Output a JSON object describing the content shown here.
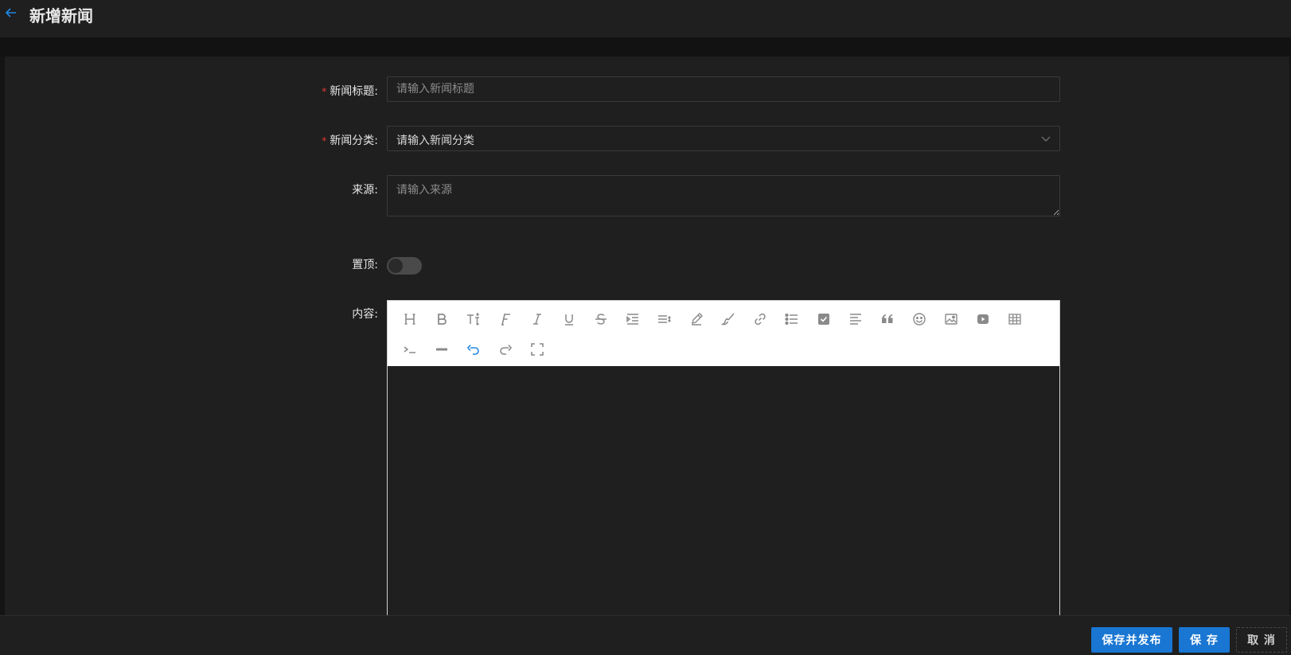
{
  "header": {
    "title": "新增新闻",
    "back_icon": "arrow-left-icon"
  },
  "form": {
    "title_label": "新闻标题:",
    "title_placeholder": "请输入新闻标题",
    "category_label": "新闻分类:",
    "category_value": "请输入新闻分类",
    "source_label": "来源:",
    "source_placeholder": "请输入来源",
    "pin_label": "置顶:",
    "pin_on": false,
    "content_label": "内容:",
    "required_mark": "*"
  },
  "editor": {
    "toolbar_row1": [
      "heading-icon",
      "bold-icon",
      "font-size-icon",
      "font-family-icon",
      "italic-icon",
      "underline-icon",
      "strikethrough-icon",
      "indent-icon",
      "line-height-icon",
      "font-color-icon",
      "background-color-icon",
      "link-icon",
      "bulleted-list-icon",
      "todo-icon",
      "justify-icon",
      "quote-icon",
      "emoticon-icon",
      "image-icon",
      "video-icon",
      "table-icon"
    ],
    "toolbar_row2": [
      "code-icon",
      "divider-icon",
      "undo-icon",
      "redo-icon",
      "fullscreen-icon"
    ]
  },
  "footer": {
    "save_publish_label": "保存并发布",
    "save_label": "保 存",
    "cancel_label": "取 消"
  },
  "colors": {
    "accent": "#1976d2",
    "required": "#e53935",
    "panel": "#1f1f1f"
  }
}
